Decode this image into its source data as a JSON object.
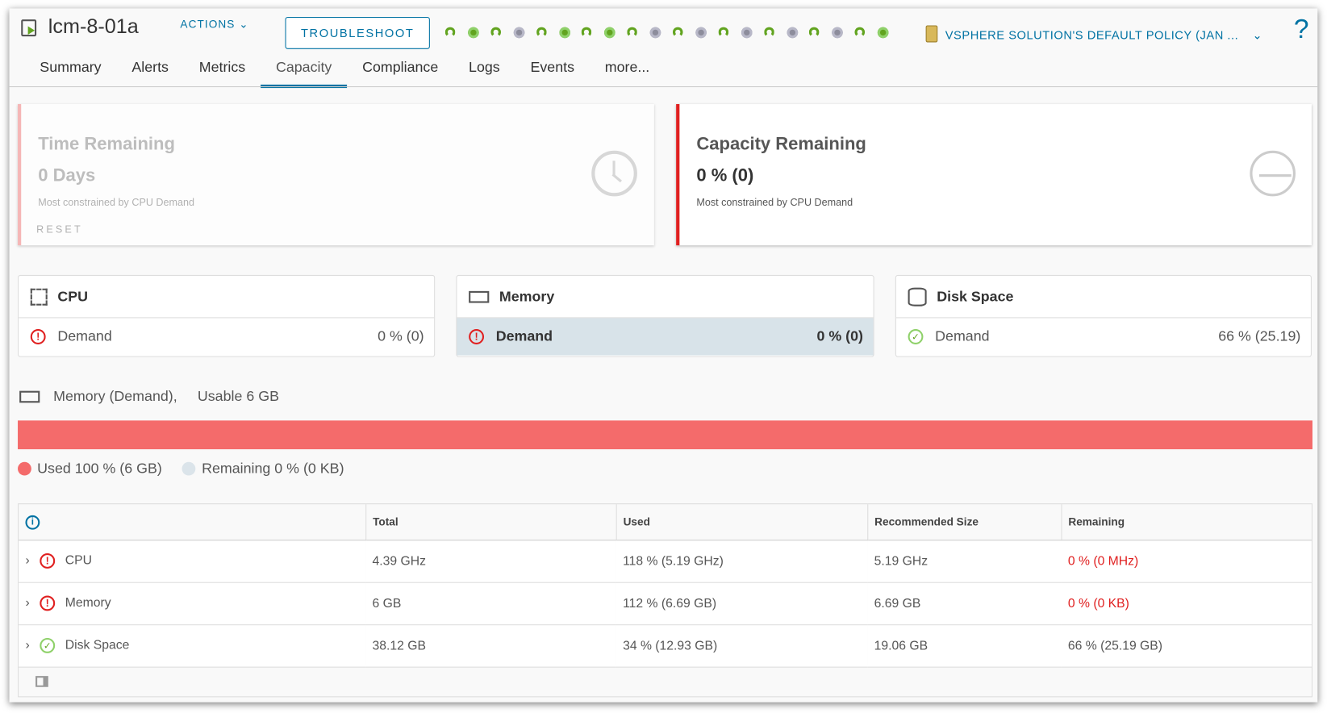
{
  "header": {
    "title": "lcm-8-01a",
    "actions_label": "ACTIONS",
    "troubleshoot_label": "TROUBLESHOOT",
    "policy_label": "VSPHERE SOLUTION'S DEFAULT POLICY (JAN ...",
    "help": "?",
    "status_icons": [
      "arc-green",
      "dot-green",
      "arc-green",
      "dot-grey",
      "arc-green",
      "dot-green",
      "arc-green",
      "dot-green",
      "arc-green",
      "dot-grey",
      "arc-green",
      "dot-grey",
      "arc-green",
      "dot-grey",
      "arc-green",
      "dot-grey",
      "arc-green",
      "dot-grey",
      "arc-green",
      "dot-green"
    ]
  },
  "tabs": [
    "Summary",
    "Alerts",
    "Metrics",
    "Capacity",
    "Compliance",
    "Logs",
    "Events",
    "more..."
  ],
  "active_tab": "Capacity",
  "time_remaining": {
    "title": "Time Remaining",
    "value": "0 Days",
    "note": "Most constrained by CPU Demand",
    "reset": "RESET"
  },
  "capacity_remaining": {
    "title": "Capacity Remaining",
    "value": "0 % (0)",
    "note": "Most constrained by CPU Demand"
  },
  "metric_cards": [
    {
      "title": "CPU",
      "row_label": "Demand",
      "row_value": "0 % (0)",
      "status": "critical"
    },
    {
      "title": "Memory",
      "row_label": "Demand",
      "row_value": "0 % (0)",
      "status": "critical",
      "selected": true
    },
    {
      "title": "Disk Space",
      "row_label": "Demand",
      "row_value": "66 % (25.19)",
      "status": "ok"
    }
  ],
  "detail": {
    "title": "Memory (Demand),",
    "usable": "Usable 6 GB",
    "used_percent": 100,
    "used_legend": "Used 100 % (6 GB)",
    "remaining_legend": "Remaining 0 % (0 KB)",
    "used_color": "#f46b6b",
    "remaining_color": "#dbe4ea"
  },
  "table": {
    "headers": [
      "",
      "Total",
      "Used",
      "Recommended Size",
      "Remaining"
    ],
    "rows": [
      {
        "name": "CPU",
        "status": "critical",
        "total": "4.39 GHz",
        "used": "118 % (5.19 GHz)",
        "recommended": "5.19 GHz",
        "remaining": "0 % (0 MHz)"
      },
      {
        "name": "Memory",
        "status": "critical",
        "total": "6 GB",
        "used": "112 % (6.69 GB)",
        "recommended": "6.69 GB",
        "remaining": "0 % (0 KB)"
      },
      {
        "name": "Disk Space",
        "status": "ok",
        "total": "38.12 GB",
        "used": "34 % (12.93 GB)",
        "recommended": "19.06 GB",
        "remaining": "66 % (25.19 GB)"
      }
    ]
  }
}
